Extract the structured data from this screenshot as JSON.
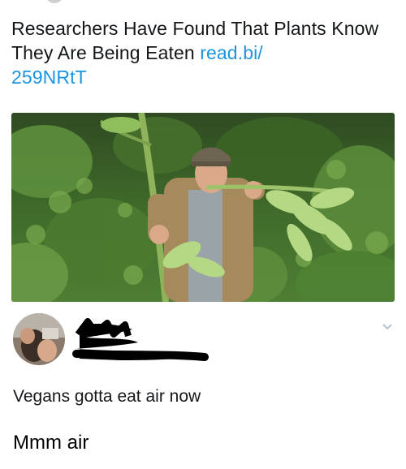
{
  "headline": {
    "text": "Researchers Have Found That Plants Know They Are Being Eaten",
    "link_line1": "read.bi/",
    "link_line2": "259NRtT",
    "link_color": "#1b95e0"
  },
  "photo": {
    "subject": "man in cap and khaki shirt biting a tall green plant stalk in front of dense foliage"
  },
  "tweet": {
    "author_redacted": true,
    "text": "Vegans gotta eat air now"
  },
  "reply": {
    "text": "Mmm air"
  },
  "icons": {
    "menu": "chevron-down-icon",
    "redaction": "redaction-scribble"
  }
}
